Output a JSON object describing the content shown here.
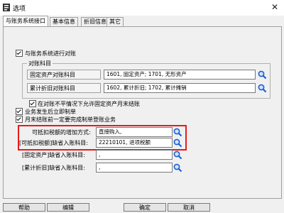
{
  "window": {
    "title": "选项"
  },
  "tabs": [
    {
      "label": "与账务系统接口"
    },
    {
      "label": "基本信息"
    },
    {
      "label": "折旧信息"
    },
    {
      "label": "其它"
    }
  ],
  "reconcile_checkbox": {
    "label": "与账务系统进行对账",
    "checked": true
  },
  "reconcile_group": {
    "title": "对账科目",
    "fixed_asset": {
      "label": "固定资产对账科目",
      "value": "1601, 固定资产; 1701, 无形资产"
    },
    "depreciation": {
      "label": "累计折旧对账科目",
      "value": "1602, 累计折旧; 1702, 累计摊销"
    }
  },
  "options": [
    {
      "label": "在对账不平情况下允许固定资产月末结账",
      "checked": true
    },
    {
      "label": "业务发生后立即制单",
      "checked": true
    },
    {
      "label": "月末结账前一定要完成制单登账业务",
      "checked": true
    }
  ],
  "tax_adjust": {
    "label": "可抵扣税额的增加方式:",
    "value": "直接购入,"
  },
  "tax_default": {
    "label": "[可抵扣税额]缺省入账科目:",
    "value": "22210101, 进项税额"
  },
  "fa_default": {
    "label": "[固定资产]缺省入账科目:",
    "value": ","
  },
  "dep_default": {
    "label": "[累计折旧]缺省入账科目:",
    "value": ","
  },
  "buttons": {
    "help": "帮助",
    "edit": "编辑",
    "ok": "确定",
    "cancel": "取消"
  },
  "colors": {
    "highlight": "#e41b1b",
    "search_icon": "#1c5fd1"
  }
}
